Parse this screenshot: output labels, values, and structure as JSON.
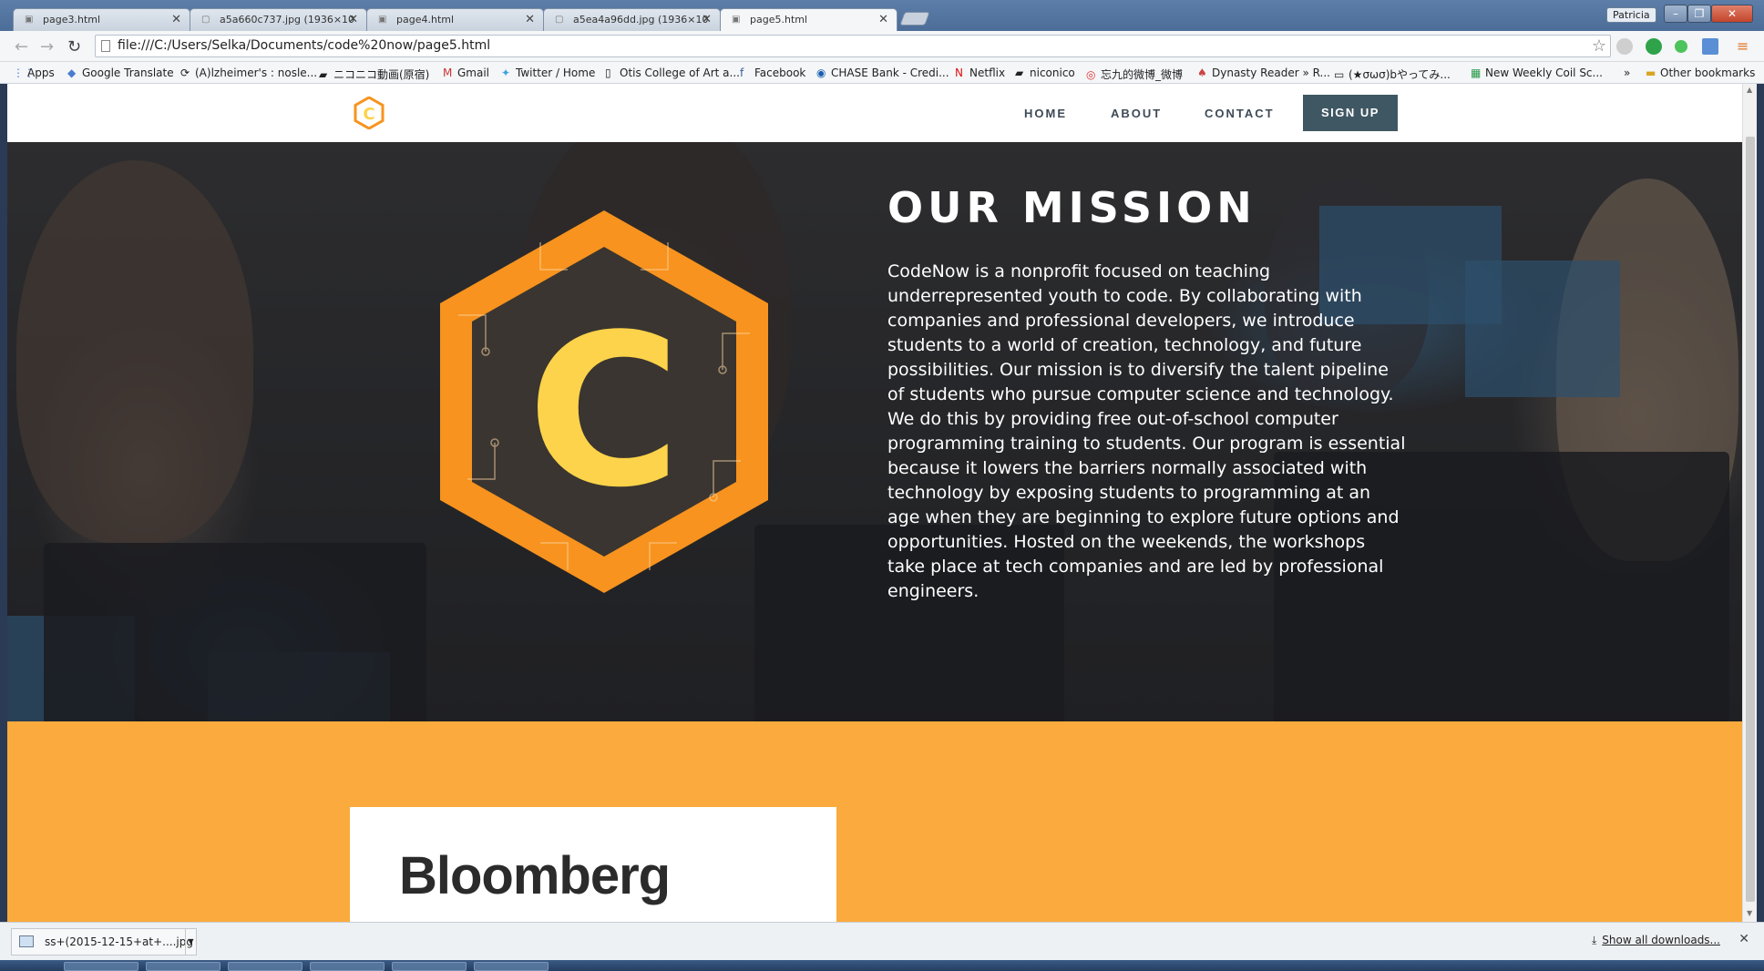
{
  "browser": {
    "tabs": [
      {
        "label": "page3.html",
        "active": false
      },
      {
        "label": "a5a660c737.jpg (1936×10",
        "active": false
      },
      {
        "label": "page4.html",
        "active": false
      },
      {
        "label": "a5ea4a96dd.jpg (1936×10",
        "active": false
      },
      {
        "label": "page5.html",
        "active": true
      }
    ],
    "profile_name": "Patricia",
    "address": "file:///C:/Users/Selka/Documents/code%20now/page5.html",
    "bookmarks": [
      {
        "label": "Apps",
        "icon": "apps-grid-icon"
      },
      {
        "label": "Google Translate",
        "icon": "translate-icon"
      },
      {
        "label": "(A)lzheimer's : nosle...",
        "icon": "tumblr-icon"
      },
      {
        "label": "ニコニコ動画(原宿)",
        "icon": "niconico-icon"
      },
      {
        "label": "Gmail",
        "icon": "gmail-icon"
      },
      {
        "label": "Twitter / Home",
        "icon": "twitter-icon"
      },
      {
        "label": "Otis College of Art a...",
        "icon": "page-icon"
      },
      {
        "label": "Facebook",
        "icon": "facebook-icon"
      },
      {
        "label": "CHASE Bank - Credi...",
        "icon": "chase-icon"
      },
      {
        "label": "Netflix",
        "icon": "netflix-icon"
      },
      {
        "label": "niconico",
        "icon": "niconico-icon"
      },
      {
        "label": "忘九的微博_微博",
        "icon": "weibo-icon"
      },
      {
        "label": "Dynasty Reader » R...",
        "icon": "dynasty-icon"
      },
      {
        "label": "(★σωσ)bやってみ...",
        "icon": "folder-page-icon"
      },
      {
        "label": "New Weekly Coil Sc...",
        "icon": "sheets-icon"
      }
    ],
    "bookmarks_overflow": "»",
    "other_bookmarks": "Other bookmarks",
    "download_item": "ss+(2015-12-15+at+....jpg",
    "show_all_downloads": "Show all downloads..."
  },
  "site": {
    "nav": {
      "home": "HOME",
      "about": "ABOUT",
      "contact": "CONTACT",
      "signup": "SIGN UP"
    },
    "logo_letter": "C",
    "mission": {
      "heading": "OUR MISSION",
      "body": "CodeNow is a nonprofit focused on teaching underrepresented youth to code. By collaborating with companies and professional developers, we introduce students to a world of creation, technology, and future possibilities. Our mission is to diversify the talent pipeline of students who pursue computer science and technology. We do this by providing free out-of-school computer programming training to students. Our program is essential because it lowers the barriers normally associated with technology by exposing students to programming at an age when they are beginning to explore future options and opportunities. Hosted on the weekends, the workshops take place at tech companies and are led by professional engineers."
    },
    "sponsor": "Bloomberg"
  },
  "colors": {
    "accent_orange": "#fbab3d",
    "signup_bg": "#3f5763",
    "nav_text": "#3e4a57",
    "logo_orange": "#f7931e",
    "logo_yellow": "#fcd34a"
  }
}
